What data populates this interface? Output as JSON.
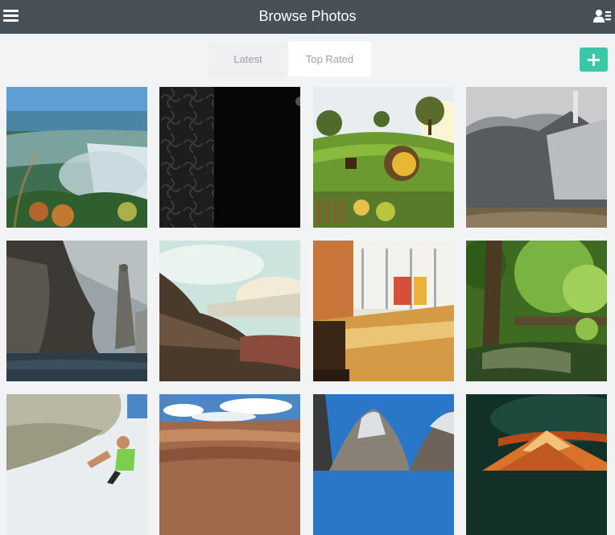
{
  "header": {
    "title": "Browse Photos",
    "menu_icon": "hamburger-menu-icon",
    "user_icon": "user-list-icon",
    "background_color": "#485058"
  },
  "tabs": [
    {
      "label": "Latest",
      "selected": false
    },
    {
      "label": "Top Rated",
      "selected": true
    }
  ],
  "add_button": {
    "icon": "plus-icon",
    "color": "#3cc8a7"
  },
  "photos": [
    {
      "subject": "waterfall-photo"
    },
    {
      "subject": "dark-pattern-photo"
    },
    {
      "subject": "hobbit-hole-photo"
    },
    {
      "subject": "mountain-city-photo"
    },
    {
      "subject": "cliff-statue-photo"
    },
    {
      "subject": "desert-landscape-photo"
    },
    {
      "subject": "studio-interior-photo"
    },
    {
      "subject": "forest-stream-photo"
    },
    {
      "subject": "rock-climber-photo"
    },
    {
      "subject": "grand-canyon-photo"
    },
    {
      "subject": "mountain-peaks-photo"
    },
    {
      "subject": "sunset-peak-photo"
    }
  ]
}
